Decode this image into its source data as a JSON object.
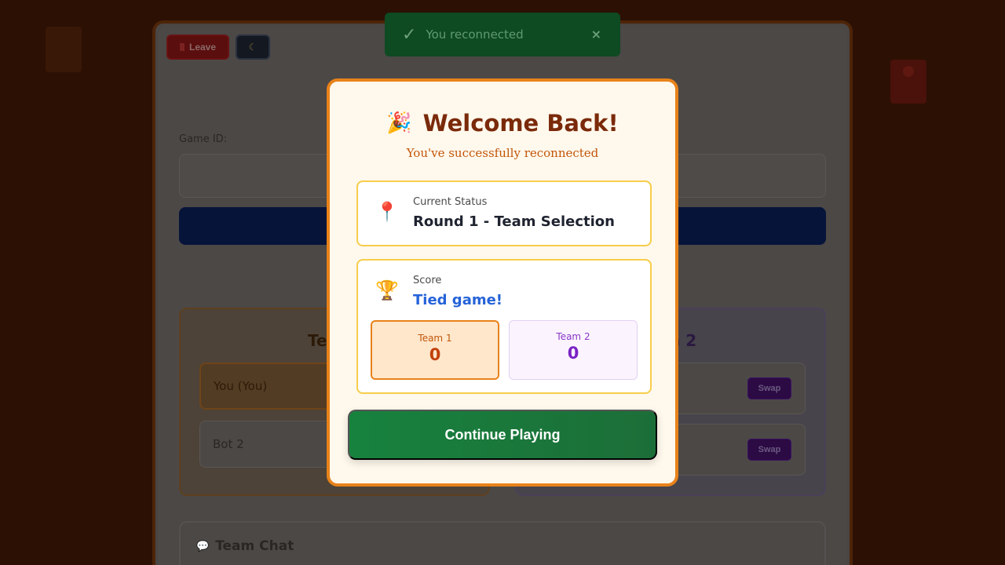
{
  "toolbar": {
    "leave_label": "Leave",
    "theme_icon": "moon-icon"
  },
  "join": {
    "game_id_label": "Game ID:"
  },
  "teams": {
    "team1_title_partial": "Tea",
    "team2_title_partial": "n 2",
    "players": [
      "You (You)",
      "Bot 2"
    ],
    "swap_label": "Swap"
  },
  "chat": {
    "title": "Team Chat"
  },
  "toast": {
    "message": "You reconnected",
    "close": "×"
  },
  "modal": {
    "title": "Welcome Back!",
    "subtitle": "You've successfully reconnected",
    "status_label": "Current Status",
    "status_value": "Round 1 - Team Selection",
    "score_label": "Score",
    "score_value": "Tied game!",
    "team1_name": "Team 1",
    "team1_score": "0",
    "team2_name": "Team 2",
    "team2_score": "0",
    "continue_label": "Continue Playing"
  },
  "colors": {
    "accent_orange": "#e8821a",
    "title_brown": "#7a2a0a",
    "success_green": "#17823e",
    "score_blue": "#2563d8",
    "team2_purple": "#7a22c4"
  }
}
